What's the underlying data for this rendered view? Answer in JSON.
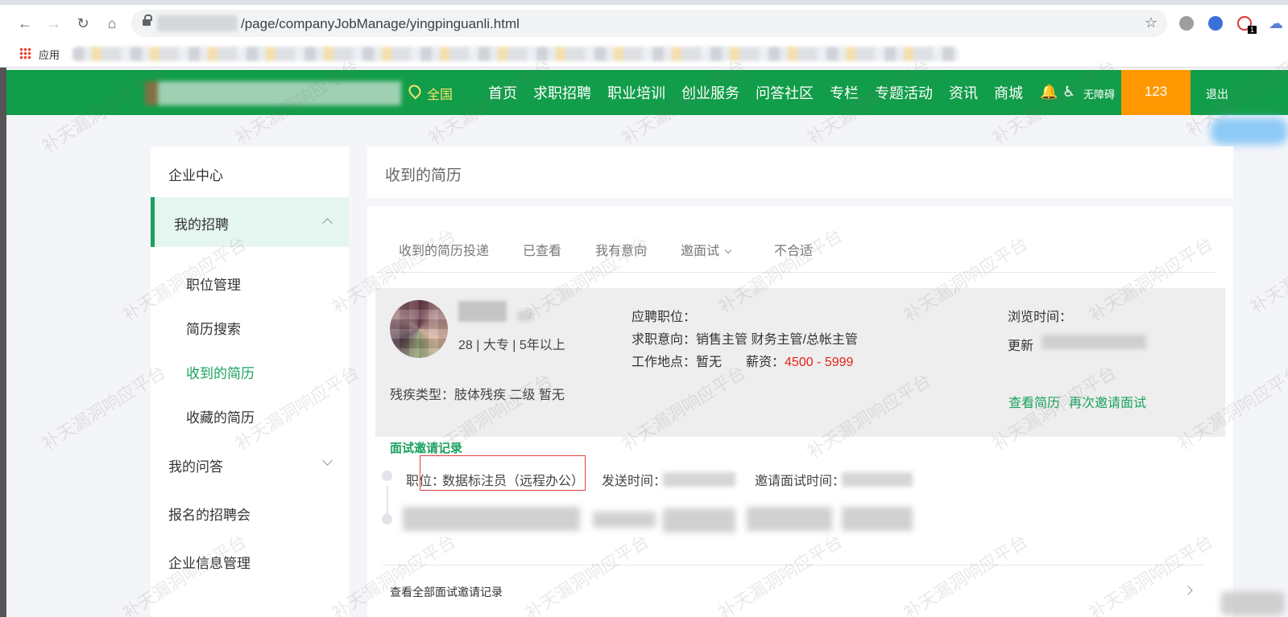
{
  "browser": {
    "url_path": "/page/companyJobManage/yingpinguanli.html",
    "apps_label": "应用",
    "ext_badge": "1"
  },
  "site": {
    "location": "全国",
    "nav": [
      "首页",
      "求职招聘",
      "职业培训",
      "创业服务",
      "问答社区",
      "专栏",
      "专题活动",
      "资讯",
      "商城"
    ],
    "accessibility": "无障碍",
    "user": "123",
    "logout": "退出",
    "accent_color": "#119d49",
    "user_box_color": "#ff9800"
  },
  "sidebar": {
    "enterprise_center": "企业中心",
    "my_recruit": "我的招聘",
    "sub": [
      "职位管理",
      "简历搜索",
      "收到的简历",
      "收藏的简历"
    ],
    "my_qa": "我的问答",
    "job_fairs": "报名的招聘会",
    "company_info": "企业信息管理"
  },
  "main": {
    "title": "收到的简历",
    "tabs": [
      "收到的简历投递",
      "已查看",
      "我有意向",
      "邀面试",
      "不合适"
    ],
    "candidate": {
      "info": "28 | 大专 | 5年以上",
      "disability": "残疾类型：肢体残疾  二级  暂无",
      "applied_position": "应聘职位：",
      "intent": "求职意向：销售主管   财务主管/总帐主管",
      "location": "工作地点：暂无",
      "salary_label": "薪资：",
      "salary": "4500 - 5999",
      "browse_time": "浏览时间：",
      "updated": "更新",
      "view_resume": "查看简历",
      "reinvite": "再次邀请面试"
    },
    "records": {
      "title": "面试邀请记录",
      "position_label": "职位：",
      "position": "数据标注员（远程办公）",
      "sent_time": "发送时间：",
      "interview_time": "邀请面试时间：",
      "view_all": "查看全部面试邀请记录"
    }
  },
  "watermark": "补天漏洞响应平台"
}
